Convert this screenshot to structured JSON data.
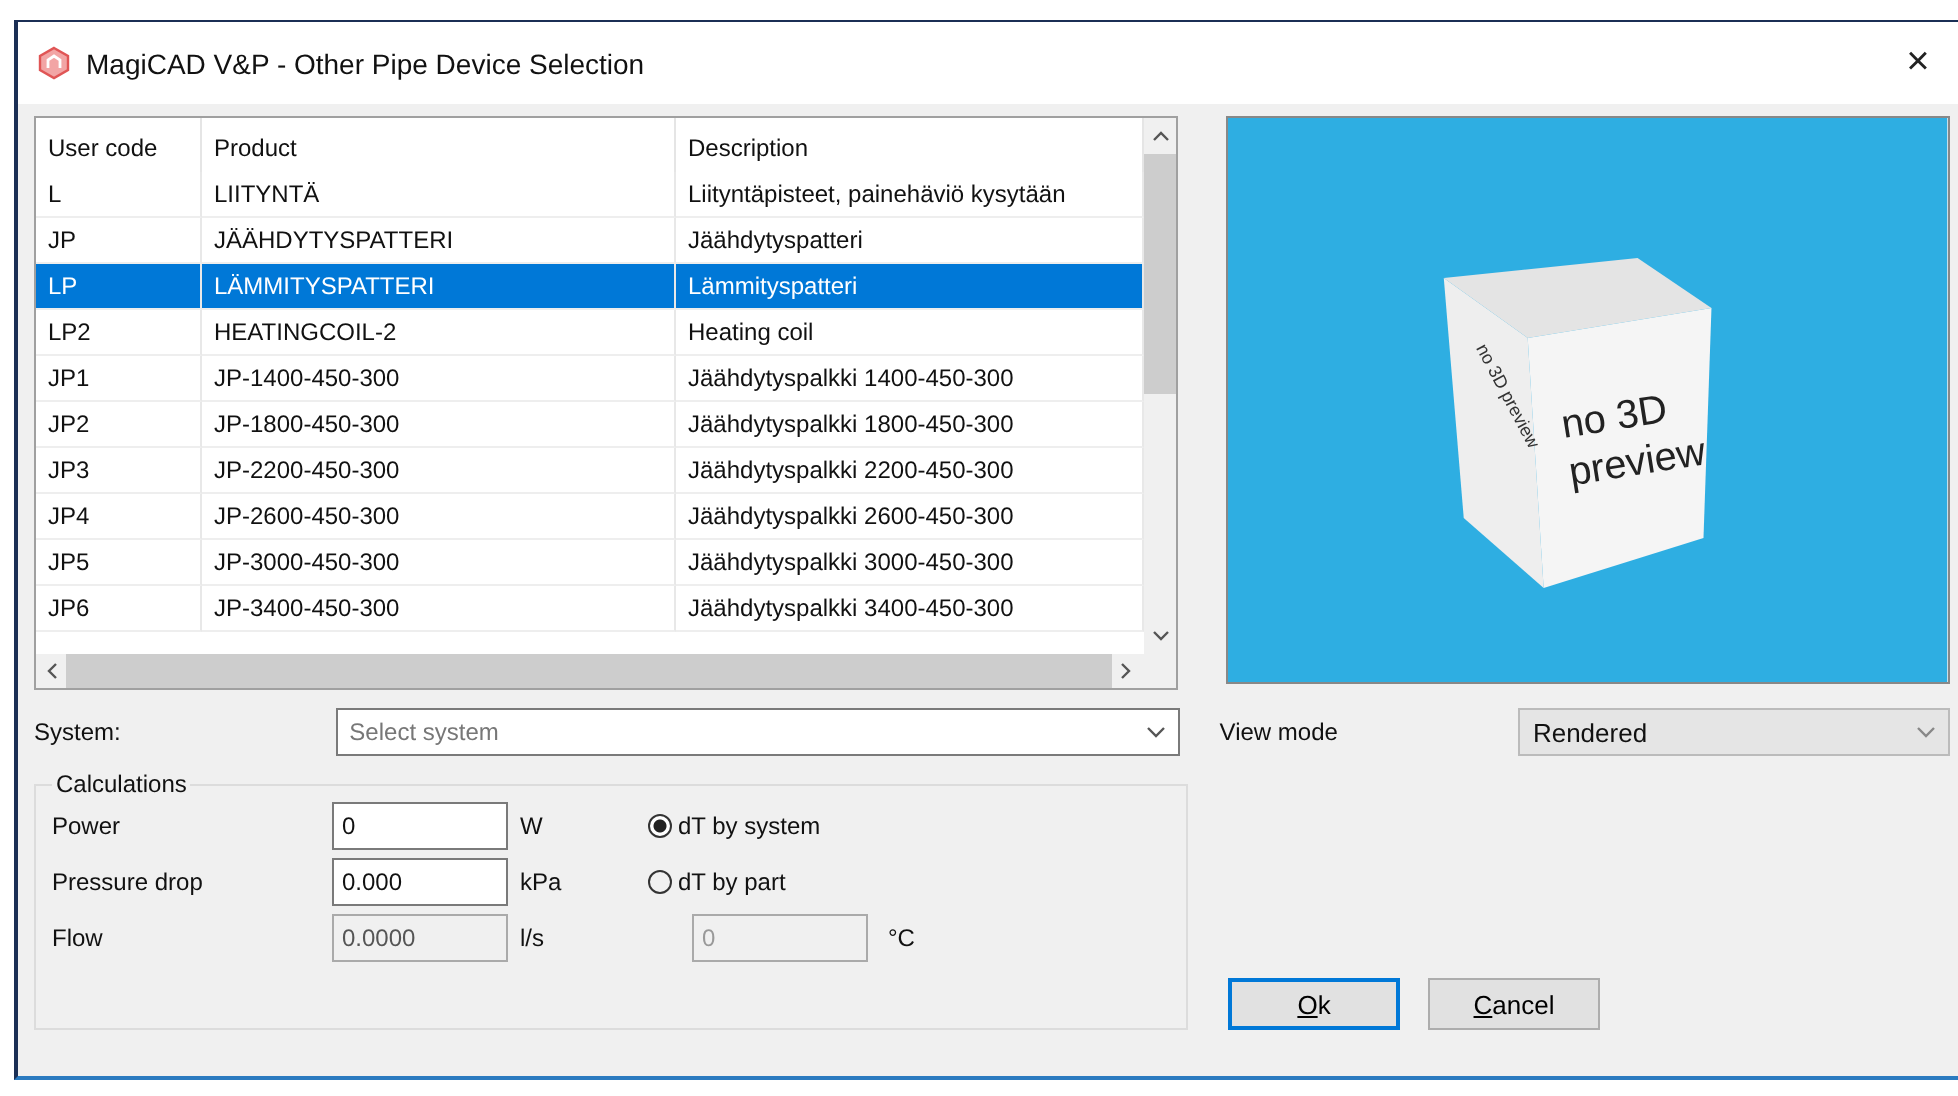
{
  "window": {
    "title": "MagiCAD V&P - Other Pipe Device Selection",
    "close": "×"
  },
  "table": {
    "columns": [
      "User code",
      "Product",
      "Description"
    ],
    "rows": [
      {
        "cells": [
          "L",
          "LIITYNTÄ",
          "Liityntäpisteet, painehäviö kysytään"
        ],
        "selected": false
      },
      {
        "cells": [
          "JP",
          "JÄÄHDYTYSPATTERI",
          "Jäähdytyspatteri"
        ],
        "selected": false
      },
      {
        "cells": [
          "LP",
          "LÄMMITYSPATTERI",
          "Lämmityspatteri"
        ],
        "selected": true
      },
      {
        "cells": [
          "LP2",
          "HEATINGCOIL-2",
          "Heating coil"
        ],
        "selected": false
      },
      {
        "cells": [
          "JP1",
          "JP-1400-450-300",
          "Jäähdytyspalkki 1400-450-300"
        ],
        "selected": false
      },
      {
        "cells": [
          "JP2",
          "JP-1800-450-300",
          "Jäähdytyspalkki 1800-450-300"
        ],
        "selected": false
      },
      {
        "cells": [
          "JP3",
          "JP-2200-450-300",
          "Jäähdytyspalkki 2200-450-300"
        ],
        "selected": false
      },
      {
        "cells": [
          "JP4",
          "JP-2600-450-300",
          "Jäähdytyspalkki 2600-450-300"
        ],
        "selected": false
      },
      {
        "cells": [
          "JP5",
          "JP-3000-450-300",
          "Jäähdytyspalkki 3000-450-300"
        ],
        "selected": false
      },
      {
        "cells": [
          "JP6",
          "JP-3400-450-300",
          "Jäähdytyspalkki 3400-450-300"
        ],
        "selected": false
      }
    ]
  },
  "preview": {
    "front_text": "no 3D preview",
    "side_text": "no 3D preview"
  },
  "system": {
    "label": "System:",
    "placeholder": "Select system"
  },
  "view_mode": {
    "label": "View mode",
    "value": "Rendered"
  },
  "calculations": {
    "title": "Calculations",
    "fields": [
      {
        "label": "Power",
        "value": "0",
        "unit": "W",
        "disabled": false
      },
      {
        "label": "Pressure drop",
        "value": "0.000",
        "unit": "kPa",
        "disabled": false
      },
      {
        "label": "Flow",
        "value": "0.0000",
        "unit": "l/s",
        "disabled": true
      }
    ],
    "options": [
      {
        "label": "dT by system",
        "selected": true
      },
      {
        "label": "dT by part",
        "selected": false
      }
    ],
    "temperature": {
      "value": "0",
      "unit": "°C",
      "disabled": true
    }
  },
  "buttons": [
    {
      "label": "Ok",
      "default": true
    },
    {
      "label": "Cancel",
      "default": false
    }
  ]
}
